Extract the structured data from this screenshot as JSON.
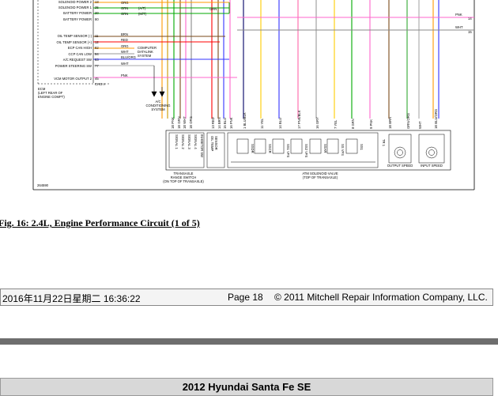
{
  "diagram": {
    "pin_labels": [
      "SOLENOID POWER 2",
      "SOLENOID POWER 1",
      "BATTERY POWER",
      "BATTERY POWER",
      "OIL TEMP SENSOR (-)",
      "OIL TEMP SENSOR (+)",
      "ECP CAN HIGH",
      "CCP CAN LOW",
      "A/C REQUEST SW",
      "POWER STEERING SW",
      "VCM MOTOR OUTPUT 2"
    ],
    "pin_numbers": [
      "13",
      "25",
      "20",
      "80",
      "11",
      "12",
      "82",
      "94",
      "83",
      "77",
      "45"
    ],
    "wire_colors_left": [
      "ORG",
      "GRN",
      "GRN",
      "BRN",
      "RED",
      "ORG",
      "WHT",
      "BLU/ORG",
      "WHT",
      "PNK"
    ],
    "wire_notes": [
      "(A/T)",
      "(M/T)"
    ],
    "grn_label": "GRN",
    "computer_label": [
      "COMPUTER",
      "DATALINK",
      "SYSTEM"
    ],
    "pnk_label": "PNK",
    "wht_label": "WHT",
    "pin14": "14",
    "pin15": "15",
    "ch_label": "CHG A",
    "ecm_note": [
      "ECM",
      "(LEFT REAR OF",
      "ENGINE COMPT)"
    ],
    "ac_label": [
      "A/C",
      "CONDITIONING",
      "SYSTEM"
    ],
    "bottom_wires": [
      "1E PNK",
      "1E GRN",
      "1E WHT",
      "1E ORG",
      "13 RED",
      "14 BRN",
      "15 BLU",
      "16 PNK",
      "1 BLU/BLK",
      "11 YEL",
      "14 BLU",
      "17 PNK/BLK",
      "16 GRY",
      "7 YEL",
      "8 GRN",
      "9 PNK",
      "1E BRN",
      "GRN/ORG",
      "WHT",
      "1E BLU/ORG"
    ],
    "trans_labels": [
      "SIGNAL 1",
      "SIGNAL 2",
      "SIGNAL 3",
      "SIGNAL 4",
      "INHIBITOR SW"
    ],
    "oil_temp_label": [
      "OIL TEMP",
      "SENSOR"
    ],
    "solenoid_names": [
      "SSDR",
      "SSCR",
      "SS1 VFS",
      "SS2 VFS",
      "SSAR",
      "SS VFS",
      "SS1"
    ],
    "tr_label": "TR 1",
    "sensor_labels": [
      "OUTPUT SPEED",
      "INPUT SPEED"
    ],
    "range_switch_label": [
      "TRANSAXLE",
      "RANGE SWITCH",
      "(ON TOP OF TRANSAXLE)"
    ],
    "solenoid_valve_label": [
      "ATM SOLENOID VALVE",
      "(TOP OF TRANSAXLE)"
    ],
    "figure_id": "264590"
  },
  "caption": "Fig. 16: 2.4L, Engine Performance Circuit (1 of 5)",
  "footer": {
    "date": "2016年11月22日星期二 16:36:22",
    "page": "Page 18",
    "copyright": "© 2011 Mitchell Repair Information Company, LLC."
  },
  "title": "2012 Hyundai Santa Fe SE"
}
